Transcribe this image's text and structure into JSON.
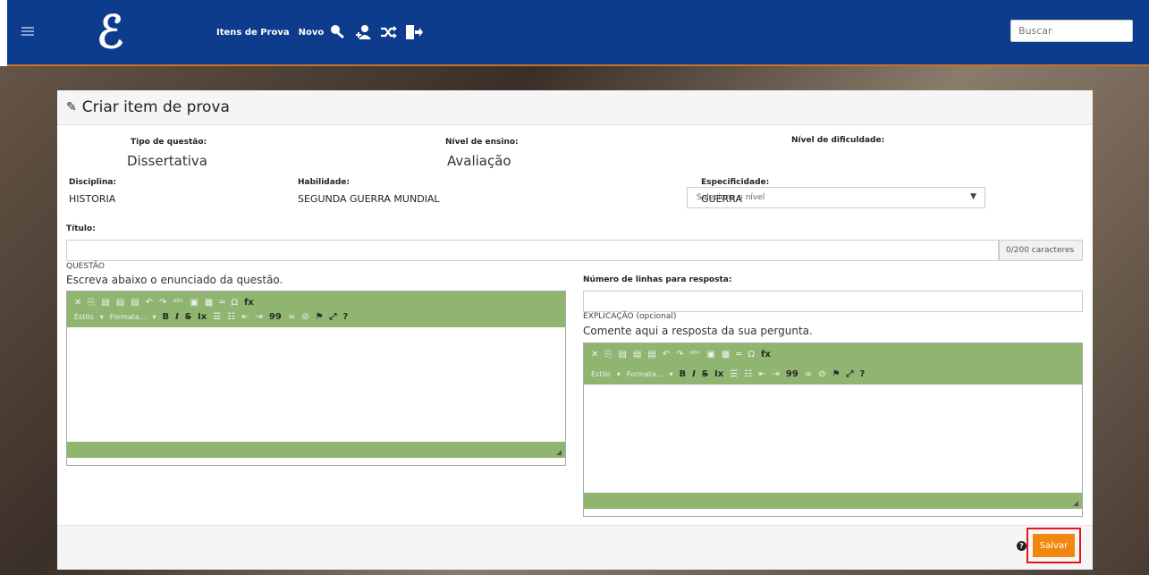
{
  "topbar": {
    "logo": "ℰ",
    "nav_items_label": "Itens de Prova",
    "nav_new_label": "Novo",
    "search_placeholder": "Buscar"
  },
  "form": {
    "title": "Criar item de prova",
    "tipo_questao_label": "Tipo de questão:",
    "tipo_questao_value": "Dissertativa",
    "nivel_ensino_label": "Nível de ensino:",
    "nivel_ensino_value": "Avaliação",
    "nivel_dificuldade_label": "Nível de dificuldade:",
    "nivel_dificuldade_placeholder": "Selecione o nível",
    "disciplina_label": "Disciplina:",
    "disciplina_value": "HISTORIA",
    "habilidade_label": "Habilidade:",
    "habilidade_value": "SEGUNDA GUERRA MUNDIAL",
    "especificidade_label": "Especificidade:",
    "especificidade_value": "GUERRA",
    "titulo_label": "Título:",
    "titulo_counter": "0/200 caracteres",
    "questao_label": "QUESTÃO",
    "questao_hint": "Escreva abaixo o enunciado da questão.",
    "linhas_label": "Número de linhas para resposta:",
    "explicacao_label": "EXPLICAÇÃO (opcional)",
    "explicacao_hint": "Comente aqui a resposta da sua pergunta.",
    "save_label": "Salvar"
  },
  "editor_toolbar": {
    "estilo": "Estilo",
    "formata": "Formata...",
    "bold": "B",
    "italic": "I",
    "strike": "S",
    "clear": "Ix",
    "quote": "99",
    "omega": "Ω",
    "fx": "fx",
    "help": "?"
  },
  "colors": {
    "topbar": "#0d3c8c",
    "accent_orange": "#f0870f",
    "editor_green": "#8fb571",
    "highlight_red": "#e8141b"
  }
}
